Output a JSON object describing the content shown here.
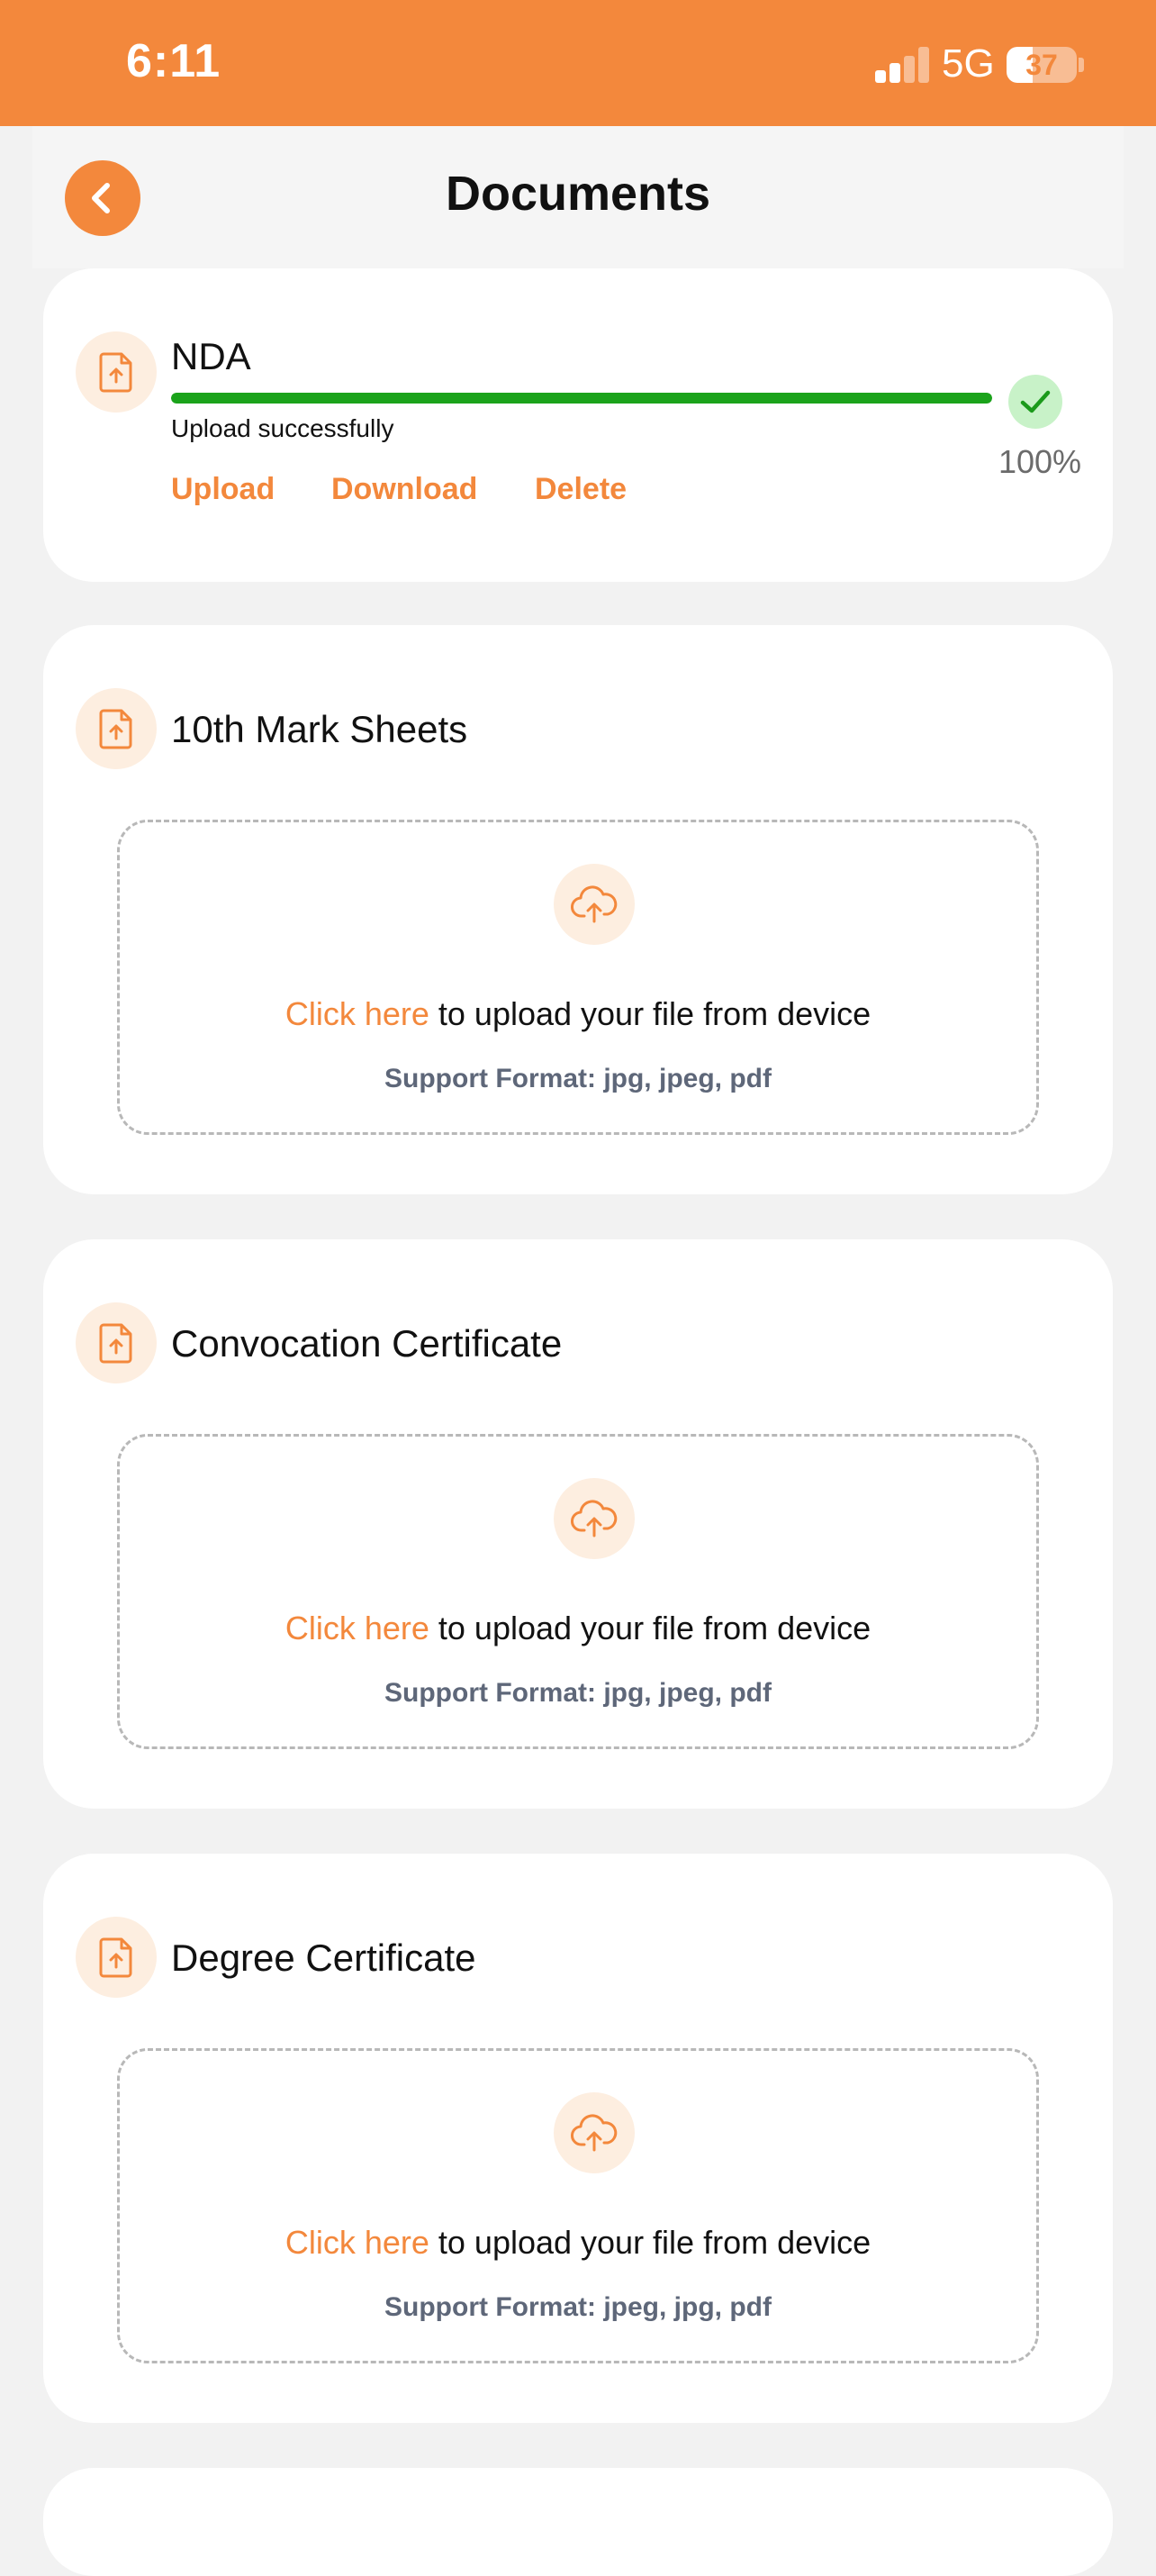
{
  "status_bar": {
    "time": "6:11",
    "network": "5G",
    "battery": "37",
    "battery_level": 0.37,
    "signal_bars_active": 2,
    "signal_bars_total": 4,
    "bg_color": "#f3883c"
  },
  "header": {
    "title": "Documents",
    "back_icon": "chevron-left-icon",
    "accent_color": "#f3883c"
  },
  "uploaded_document": {
    "title": "NDA",
    "icon": "file-upload-icon",
    "status_text": "Upload successfully",
    "progress": 1.0,
    "percent_label": "100%",
    "progress_color": "#1ba31b",
    "status_icon": "check-icon",
    "actions": {
      "upload": "Upload",
      "download": "Download",
      "delete": "Delete"
    }
  },
  "pending_documents": [
    {
      "title": "10th Mark Sheets",
      "icon": "file-upload-icon",
      "dropzone": {
        "icon": "cloud-upload-icon",
        "click_here": "Click here",
        "instruction": " to upload your file from device",
        "formats": "Support Format: jpg, jpeg, pdf"
      }
    },
    {
      "title": "Convocation Certificate",
      "icon": "file-upload-icon",
      "dropzone": {
        "icon": "cloud-upload-icon",
        "click_here": "Click here",
        "instruction": " to upload your file from device",
        "formats": "Support Format: jpg, jpeg, pdf"
      }
    },
    {
      "title": "Degree Certificate",
      "icon": "file-upload-icon",
      "dropzone": {
        "icon": "cloud-upload-icon",
        "click_here": "Click here",
        "instruction": " to upload your file from device",
        "formats": "Support Format: jpeg, jpg, pdf"
      }
    }
  ]
}
